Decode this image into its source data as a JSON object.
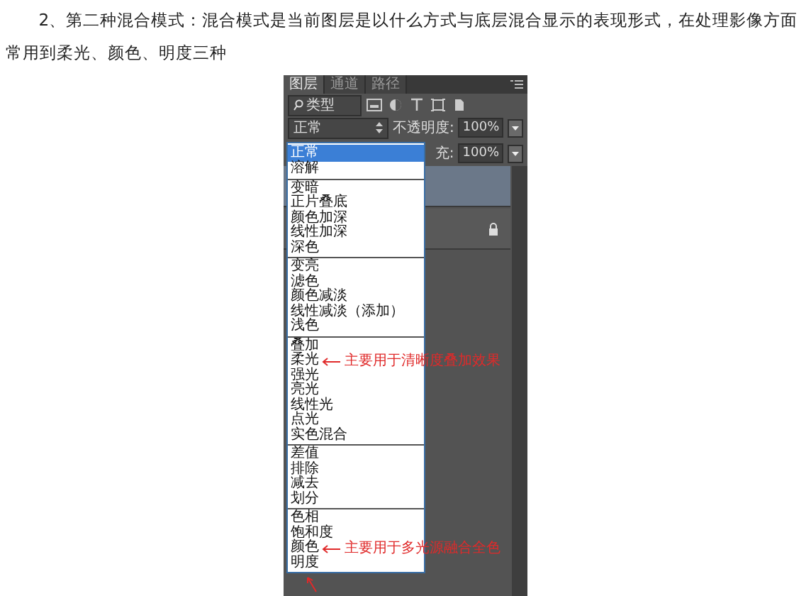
{
  "article": {
    "paragraph": "2、第二种混合模式：混合模式是当前图层是以什么方式与底层混合显示的表现形式，在处理影像方面常用到柔光、颜色、明度三种"
  },
  "panel": {
    "tabs": [
      {
        "label": "图层",
        "selected": true
      },
      {
        "label": "通道",
        "selected": false
      },
      {
        "label": "路径",
        "selected": false
      }
    ],
    "filter": {
      "value": "类型"
    },
    "blend_mode": {
      "value": "正常"
    },
    "opacity": {
      "label": "不透明度:",
      "value": "100%"
    },
    "fill": {
      "label": "充:",
      "value": "100%"
    },
    "layers": [
      {
        "selected": true,
        "locked": false
      },
      {
        "selected": false,
        "locked": true
      }
    ],
    "menu": {
      "groups": [
        {
          "items": [
            {
              "label": "正常",
              "selected": true
            },
            {
              "label": "溶解",
              "selected": false
            }
          ]
        },
        {
          "items": [
            {
              "label": "变暗",
              "selected": false
            },
            {
              "label": "正片叠底",
              "selected": false
            },
            {
              "label": "颜色加深",
              "selected": false
            },
            {
              "label": "线性加深",
              "selected": false
            },
            {
              "label": "深色",
              "selected": false
            }
          ]
        },
        {
          "items": [
            {
              "label": "变亮",
              "selected": false
            },
            {
              "label": "滤色",
              "selected": false
            },
            {
              "label": "颜色减淡",
              "selected": false
            },
            {
              "label": "线性减淡（添加）",
              "selected": false
            },
            {
              "label": "浅色",
              "selected": false
            }
          ]
        },
        {
          "items": [
            {
              "label": "叠加",
              "selected": false
            },
            {
              "label": "柔光",
              "selected": false,
              "note": "主要用于清晰度叠加效果"
            },
            {
              "label": "强光",
              "selected": false
            },
            {
              "label": "亮光",
              "selected": false
            },
            {
              "label": "线性光",
              "selected": false
            },
            {
              "label": "点光",
              "selected": false
            },
            {
              "label": "实色混合",
              "selected": false
            }
          ]
        },
        {
          "items": [
            {
              "label": "差值",
              "selected": false
            },
            {
              "label": "排除",
              "selected": false
            },
            {
              "label": "减去",
              "selected": false
            },
            {
              "label": "划分",
              "selected": false
            }
          ]
        },
        {
          "items": [
            {
              "label": "色相",
              "selected": false
            },
            {
              "label": "饱和度",
              "selected": false
            },
            {
              "label": "颜色",
              "selected": false,
              "note": "主要用于多光源融合全色"
            },
            {
              "label": "明度",
              "selected": false
            }
          ]
        }
      ]
    }
  }
}
